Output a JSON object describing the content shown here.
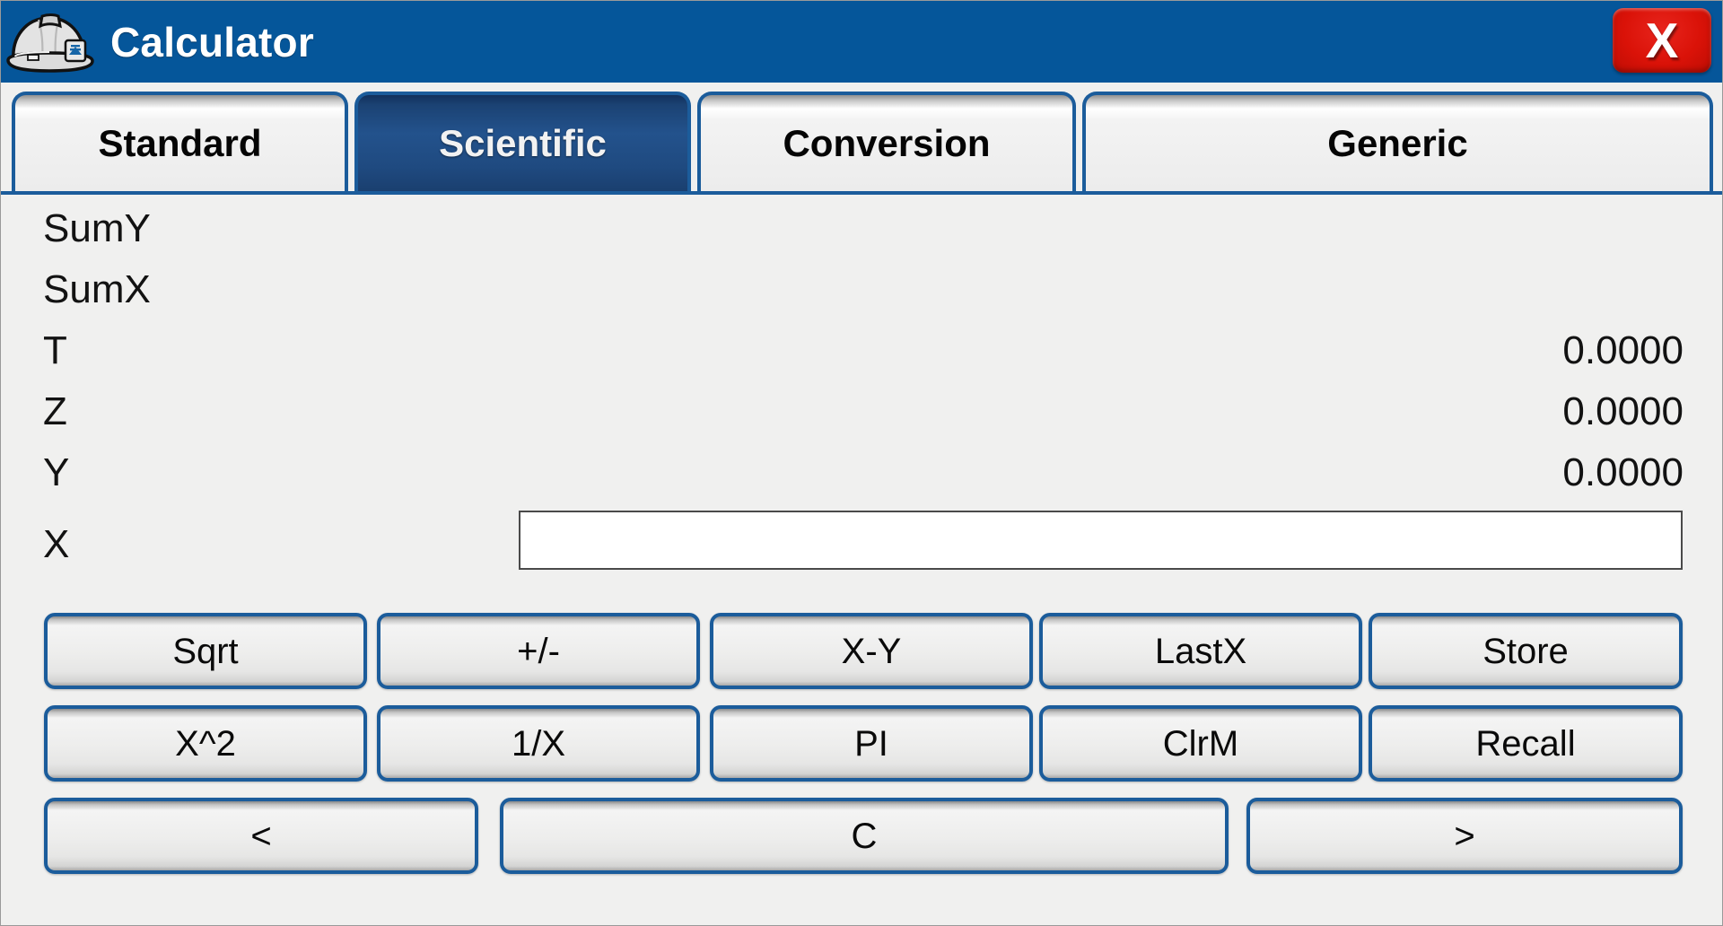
{
  "window": {
    "title": "Calculator",
    "icon": "hard-hat-icon",
    "close_label": "X",
    "titlebar_color": "#05569a",
    "accent_color": "#1b5c9b",
    "active_tab_color": "#1f4a80",
    "close_color": "#da1208",
    "surface_color": "#f0f0ef"
  },
  "tabs": [
    {
      "label": "Standard",
      "active": false
    },
    {
      "label": "Scientific",
      "active": true
    },
    {
      "label": "Conversion",
      "active": false
    },
    {
      "label": "Generic",
      "active": false
    }
  ],
  "registers": [
    {
      "label": "SumY",
      "value": ""
    },
    {
      "label": "SumX",
      "value": ""
    },
    {
      "label": "T",
      "value": "0.0000"
    },
    {
      "label": "Z",
      "value": "0.0000"
    },
    {
      "label": "Y",
      "value": "0.0000"
    }
  ],
  "x_register": {
    "label": "X",
    "value": "",
    "placeholder": ""
  },
  "keypad": {
    "row1": [
      {
        "label": "Sqrt"
      },
      {
        "label": "+/-"
      },
      {
        "label": "X-Y"
      },
      {
        "label": "LastX"
      },
      {
        "label": "Store"
      }
    ],
    "row2": [
      {
        "label": "X^2"
      },
      {
        "label": "1/X"
      },
      {
        "label": "PI"
      },
      {
        "label": "ClrM"
      },
      {
        "label": "Recall"
      }
    ],
    "row3": [
      {
        "label": "<"
      },
      {
        "label": "C"
      },
      {
        "label": ">"
      }
    ]
  }
}
